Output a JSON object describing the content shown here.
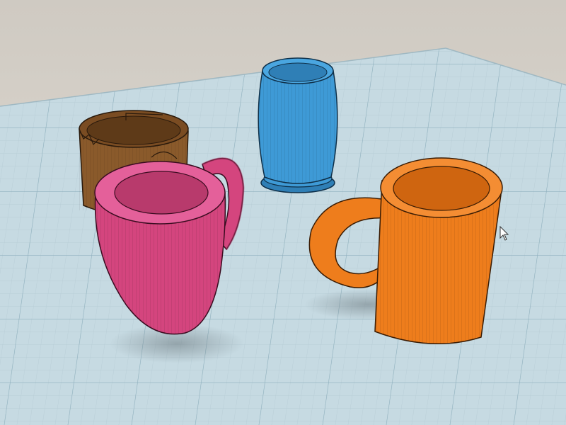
{
  "scene": {
    "background_color": "#d9d4cc",
    "workplane_color": "#c4d8e0",
    "grid_minor_color": "#b0c8d2",
    "grid_major_color": "#8fb0be",
    "objects": [
      {
        "name": "brown-cup",
        "shape": "cup-cut-rim",
        "color": "#8a5a2b",
        "color_dark": "#6e4520"
      },
      {
        "name": "blue-cup",
        "shape": "barrel-cup",
        "color": "#3e9ad6",
        "color_dark": "#2f7fb6"
      },
      {
        "name": "pink-mug",
        "shape": "tapered-mug-with-handle",
        "color": "#d4457e",
        "color_dark": "#a83462"
      },
      {
        "name": "orange-mug",
        "shape": "cylinder-mug-with-handle",
        "color": "#ee7d1c",
        "color_dark": "#c2600e"
      }
    ],
    "cursor": {
      "icon": "arrow-cursor-icon"
    }
  }
}
